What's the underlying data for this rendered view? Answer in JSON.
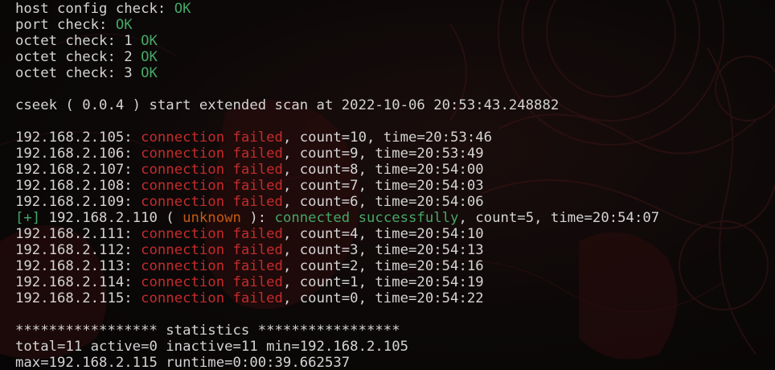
{
  "checks": [
    {
      "label": "host config check: ",
      "status": "OK"
    },
    {
      "label": "port check: ",
      "status": "OK"
    },
    {
      "label": "octet check: 1 ",
      "status": "OK"
    },
    {
      "label": "octet check: 2 ",
      "status": "OK"
    },
    {
      "label": "octet check: 3 ",
      "status": "OK"
    }
  ],
  "banner": "cseek ( 0.0.4 ) start extended scan at 2022-10-06 20:53:43.248882",
  "results": [
    {
      "ip": "192.168.2.105: ",
      "msg": "connection failed",
      "rest": ", count=10, time=20:53:46"
    },
    {
      "ip": "192.168.2.106: ",
      "msg": "connection failed",
      "rest": ", count=9, time=20:53:49"
    },
    {
      "ip": "192.168.2.107: ",
      "msg": "connection failed",
      "rest": ", count=8, time=20:54:00"
    },
    {
      "ip": "192.168.2.108: ",
      "msg": "connection failed",
      "rest": ", count=7, time=20:54:03"
    },
    {
      "ip": "192.168.2.109: ",
      "msg": "connection failed",
      "rest": ", count=6, time=20:54:06"
    }
  ],
  "success": {
    "tag": "[+]",
    "ip": " 192.168.2.110 ( ",
    "host": "unknown",
    "mid": " ): ",
    "msg": "connected successfully",
    "rest": ", count=5, time=20:54:07"
  },
  "results2": [
    {
      "ip": "192.168.2.111: ",
      "msg": "connection failed",
      "rest": ", count=4, time=20:54:10"
    },
    {
      "ip": "192.168.2.112: ",
      "msg": "connection failed",
      "rest": ", count=3, time=20:54:13"
    },
    {
      "ip": "192.168.2.113: ",
      "msg": "connection failed",
      "rest": ", count=2, time=20:54:16"
    },
    {
      "ip": "192.168.2.114: ",
      "msg": "connection failed",
      "rest": ", count=1, time=20:54:19"
    },
    {
      "ip": "192.168.2.115: ",
      "msg": "connection failed",
      "rest": ", count=0, time=20:54:22"
    }
  ],
  "stats": {
    "header": "***************** statistics *****************",
    "line1": "total=11 active=0 inactive=11 min=192.168.2.105",
    "line2": "max=192.168.2.115 runtime=0:00:39.662537"
  },
  "colors": {
    "ok": "#45a765",
    "fail": "#c42b2b",
    "unknown": "#c45a10",
    "text": "#d4d4d4",
    "background": "#0a0707"
  }
}
